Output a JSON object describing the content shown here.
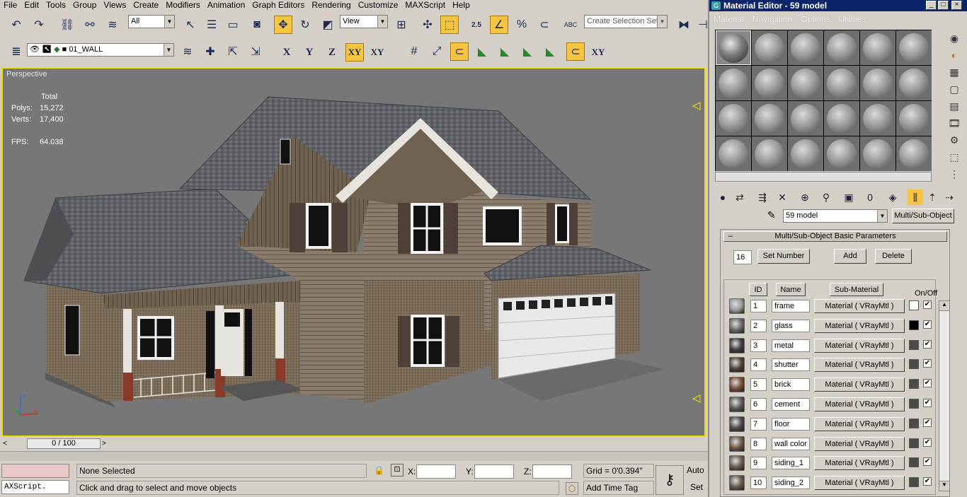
{
  "app": {
    "menu": [
      "File",
      "Edit",
      "Tools",
      "Group",
      "Views",
      "Create",
      "Modifiers",
      "Animation",
      "Graph Editors",
      "Rendering",
      "Customize",
      "MAXScript",
      "Help"
    ]
  },
  "toolbar": {
    "selection_filter": "All",
    "ref_coord": "View",
    "named_selection_placeholder": "Create Selection Set",
    "layer": "01_WALL",
    "snap_label": "2.5",
    "axis_buttons": [
      "X",
      "Y",
      "Z",
      "XY",
      "XY"
    ]
  },
  "viewport": {
    "label": "Perspective",
    "stats": {
      "header": "Total",
      "rows": [
        {
          "k": "Polys:",
          "v": "15,272"
        },
        {
          "k": "Verts:",
          "v": "17,400"
        }
      ],
      "fps_label": "FPS:",
      "fps": "64.038"
    },
    "colors": {
      "wall": "#7e6e5c",
      "siding": "#8a7d6c",
      "roof": "#5c5f63",
      "trim": "#e7e4df",
      "background": "#777777",
      "border": "#f0e000"
    }
  },
  "timeline": {
    "frame": "0 / 100"
  },
  "status": {
    "maxscript": "AXScript.",
    "selection": "None Selected",
    "prompt": "Click and drag to select and move objects",
    "x_label": "X:",
    "y_label": "Y:",
    "z_label": "Z:",
    "grid": "Grid = 0'0.394\"",
    "time_tag": "Add Time Tag",
    "auto": "Auto",
    "set": "Set"
  },
  "material_editor": {
    "title": "Material Editor - 59 model",
    "menu": [
      "Material",
      "Navigation",
      "Options",
      "Utilities"
    ],
    "material_name": "59 model",
    "material_type": "Multi/Sub-Object",
    "rollout_title": "Multi/Sub-Object Basic Parameters",
    "count": "16",
    "set_number": "Set Number",
    "add": "Add",
    "delete": "Delete",
    "headers": {
      "id": "ID",
      "name": "Name",
      "sub": "Sub-Material",
      "onoff": "On/Off"
    },
    "rows": [
      {
        "id": "1",
        "name": "frame",
        "mat": "Material  ( VRayMtl )",
        "color": "#ffffff",
        "swatch": "#9a9a9a"
      },
      {
        "id": "2",
        "name": "glass",
        "mat": "Material  ( VRayMtl )",
        "color": "#000000",
        "swatch": "#6a6a6a"
      },
      {
        "id": "3",
        "name": "metal",
        "mat": "Material  ( VRayMtl )",
        "color": "#4a4a4a",
        "swatch": "#3c3c3c"
      },
      {
        "id": "4",
        "name": "shutter",
        "mat": "Material  ( VRayMtl )",
        "color": "#4a4a4a",
        "swatch": "#4d4139"
      },
      {
        "id": "5",
        "name": "brick",
        "mat": "Material  ( VRayMtl )",
        "color": "#4a4a4a",
        "swatch": "#7a4a3a"
      },
      {
        "id": "6",
        "name": "cement",
        "mat": "Material  ( VRayMtl )",
        "color": "#4a4a4a",
        "swatch": "#5a5a5a"
      },
      {
        "id": "7",
        "name": "floor",
        "mat": "Material  ( VRayMtl )",
        "color": "#4a4a4a",
        "swatch": "#4a4a4a"
      },
      {
        "id": "8",
        "name": "wall color",
        "mat": "Material  ( VRayMtl )",
        "color": "#4a4a4a",
        "swatch": "#6b5a48"
      },
      {
        "id": "9",
        "name": "siding_1",
        "mat": "Material  ( VRayMtl )",
        "color": "#4a4a4a",
        "swatch": "#6a5d4f"
      },
      {
        "id": "10",
        "name": "siding_2",
        "mat": "Material  ( VRayMtl )",
        "color": "#4a4a4a",
        "swatch": "#665a4c"
      }
    ]
  }
}
